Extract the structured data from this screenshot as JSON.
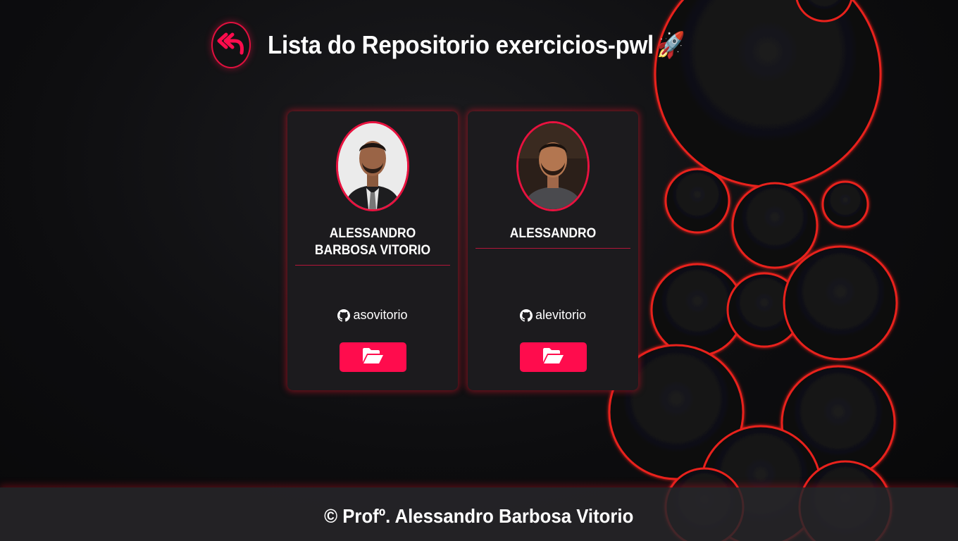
{
  "header": {
    "title": "Lista do Repositorio exercicios-pwl",
    "title_emoji": "🚀",
    "back_icon": "reply-all-icon"
  },
  "cards": [
    {
      "name": "ALESSANDRO BARBOSA VITORIO",
      "github_icon": "github-icon",
      "github_user": "asovitorio",
      "repo_icon": "folder-open-icon"
    },
    {
      "name": "ALESSANDRO",
      "github_icon": "github-icon",
      "github_user": "alevitorio",
      "repo_icon": "folder-open-icon"
    }
  ],
  "footer": {
    "text": "© Profº. Alessandro Barbosa Vitorio"
  },
  "colors": {
    "accent": "#ff0c4d",
    "background": "#0b0b0d",
    "card": "#1c1b1e",
    "footer": "#28272a"
  }
}
